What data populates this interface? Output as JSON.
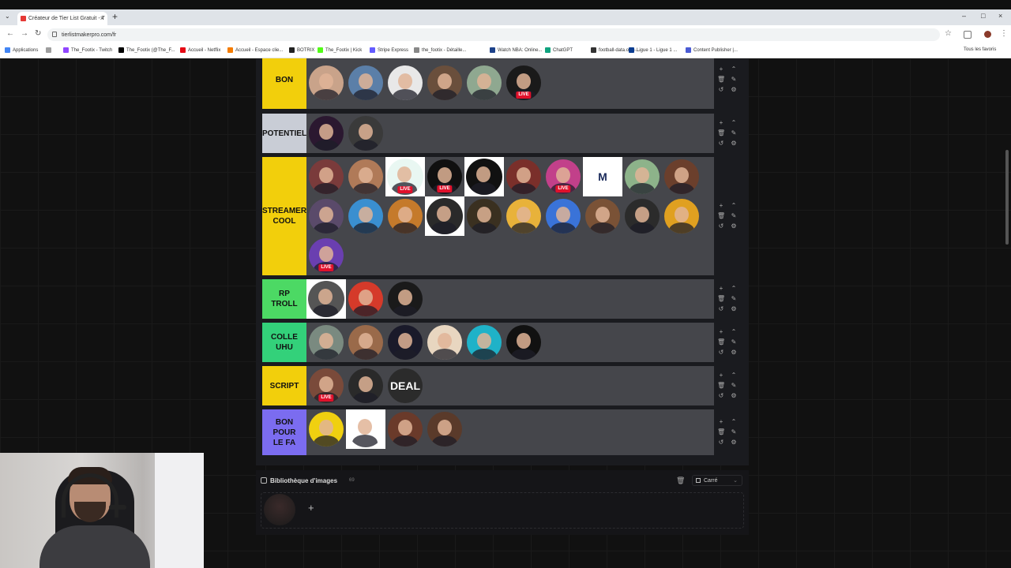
{
  "browser": {
    "tab_title": "Créateur de Tier List Gratuit - T",
    "new_tab": "+",
    "url": "tierlistmakerpro.com/fr",
    "bookmarks": [
      {
        "label": "Applications",
        "color": "#4285f4"
      },
      {
        "label": "",
        "color": "#9e9e9e"
      },
      {
        "label": "The_Footix - Twitch",
        "color": "#9146ff"
      },
      {
        "label": "The_Footix (@The_F...",
        "color": "#000000"
      },
      {
        "label": "Accueil - Netflix",
        "color": "#e50914"
      },
      {
        "label": "Accueil - Espace clie...",
        "color": "#f57c00"
      },
      {
        "label": "BOTRIX",
        "color": "#222222"
      },
      {
        "label": "The_Footix | Kick",
        "color": "#53fc18"
      },
      {
        "label": "Stripe Express",
        "color": "#635bff"
      },
      {
        "label": "the_footix - Détaille...",
        "color": "#888888"
      },
      {
        "label": "Watch NBA: Online...",
        "color": "#1d428a"
      },
      {
        "label": "ChatGPT",
        "color": "#10a37f"
      },
      {
        "label": "football-data.org -...",
        "color": "#333333"
      },
      {
        "label": "Ligue 1 - Ligue 1 ...",
        "color": "#0b3d91"
      },
      {
        "label": "Content Publisher |...",
        "color": "#4a5bd4"
      }
    ],
    "all_bookmarks": "Tous les favoris"
  },
  "tiers": [
    {
      "label": "BON",
      "color": "#f2cf0c",
      "rows": 1,
      "top_partial": true,
      "items": [
        {
          "bg": "#c9a38a",
          "sq": false
        },
        {
          "bg": "#5b7fa8",
          "sq": false
        },
        {
          "bg": "#e8e8e8",
          "sq": false
        },
        {
          "bg": "#6a4f3c",
          "sq": false
        },
        {
          "bg": "#8fa890",
          "sq": false
        },
        {
          "bg": "#1a1a1a",
          "sq": false,
          "live": "LIVE"
        }
      ]
    },
    {
      "label": "POTENTIEL",
      "color": "#c9cdd6",
      "rows": 1,
      "items": [
        {
          "bg": "#2b1830",
          "sq": false
        },
        {
          "bg": "#3a3a3a",
          "sq": false
        }
      ]
    },
    {
      "label": "STREAMER\nCOOL",
      "color": "#f2cf0c",
      "rows": 3,
      "items": [
        {
          "bg": "#7a3b3b",
          "sq": false
        },
        {
          "bg": "#b07a58",
          "sq": false
        },
        {
          "bg": "#e9f7f2",
          "sq": true,
          "live": "LIVE"
        },
        {
          "bg": "#101010",
          "sq": false,
          "live": "LIVE"
        },
        {
          "bg": "#111111",
          "sq": true
        },
        {
          "bg": "#7a2f2a",
          "sq": false
        },
        {
          "bg": "#c2408a",
          "sq": false,
          "live": "LIVE"
        },
        {
          "bg": "#ffffff",
          "sq": true,
          "mono": "M"
        },
        {
          "bg": "#8db38a",
          "sq": false
        },
        {
          "bg": "#6b3f2c",
          "sq": false
        },
        {
          "bg": "#5a4a6a",
          "sq": false
        },
        {
          "bg": "#3a8fd0",
          "sq": false
        },
        {
          "bg": "#c57a2b",
          "sq": false
        },
        {
          "bg": "#2a2a2a",
          "sq": true
        },
        {
          "bg": "#3a3020",
          "sq": false
        },
        {
          "bg": "#e8b23a",
          "sq": false
        },
        {
          "bg": "#3a73d8",
          "sq": false
        },
        {
          "bg": "#7a5236",
          "sq": false
        },
        {
          "bg": "#2b2b2b",
          "sq": false
        },
        {
          "bg": "#e0a020",
          "sq": false
        },
        {
          "bg": "#6a3fb0",
          "sq": false,
          "live": "LIVE"
        }
      ]
    },
    {
      "label": "RP\nTROLL",
      "color": "#4cd964",
      "rows": 1,
      "items": [
        {
          "bg": "#555555",
          "sq": true
        },
        {
          "bg": "#d53a2a",
          "sq": false
        },
        {
          "bg": "#1a1a1a",
          "sq": false
        }
      ]
    },
    {
      "label": "COLLE\nUHU",
      "color": "#33d17a",
      "rows": 1,
      "items": [
        {
          "bg": "#7a8a80",
          "sq": false
        },
        {
          "bg": "#9a6a4a",
          "sq": false
        },
        {
          "bg": "#1a1a2a",
          "sq": false
        },
        {
          "bg": "#e8d6c0",
          "sq": false
        },
        {
          "bg": "#1fb2c8",
          "sq": false
        },
        {
          "bg": "#111111",
          "sq": false
        }
      ]
    },
    {
      "label": "SCRIPT",
      "color": "#f2cf0c",
      "rows": 1,
      "items": [
        {
          "bg": "#7a4a3a",
          "sq": false,
          "live": "LIVE"
        },
        {
          "bg": "#2a2a2a",
          "sq": false
        },
        {
          "bg": "#2b2b2b",
          "sq": false,
          "mono": "DEAL"
        }
      ]
    },
    {
      "label": "BON\nPOUR\nLE FA",
      "color": "#7b6cf0",
      "rows": 1,
      "items": [
        {
          "bg": "#f0d010",
          "sq": false
        },
        {
          "bg": "#ffffff",
          "sq": true
        },
        {
          "bg": "#6a3a2a",
          "sq": false
        },
        {
          "bg": "#5a3a2a",
          "sq": false
        }
      ]
    }
  ],
  "library": {
    "title": "Bibliothèque d'images",
    "count": "69",
    "shape_select": "Carré",
    "add_button": "+"
  }
}
